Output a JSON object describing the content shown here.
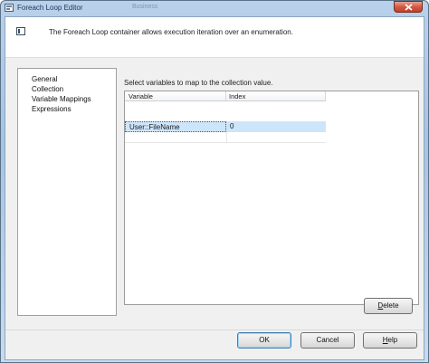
{
  "window": {
    "title": "Foreach Loop Editor",
    "ghost_title": "Business"
  },
  "header": {
    "description": "The Foreach Loop container allows execution iteration over an enumeration."
  },
  "nav": {
    "items": [
      {
        "label": "General"
      },
      {
        "label": "Collection"
      },
      {
        "label": "Variable Mappings"
      },
      {
        "label": "Expressions"
      }
    ]
  },
  "main": {
    "instruction": "Select variables to map to the collection value.",
    "columns": [
      "Variable",
      "Index"
    ],
    "rows": [
      {
        "variable": "User::FileName",
        "index": "0"
      }
    ]
  },
  "buttons": {
    "delete_pre": "",
    "delete_mnemonic": "D",
    "delete_post": "elete",
    "ok": "OK",
    "cancel": "Cancel",
    "help_mnemonic": "H",
    "help_post": "elp"
  },
  "colors": {
    "selection": "#cde5fb",
    "title_bar": "#b9d1ea",
    "close_button": "#d35a43"
  }
}
